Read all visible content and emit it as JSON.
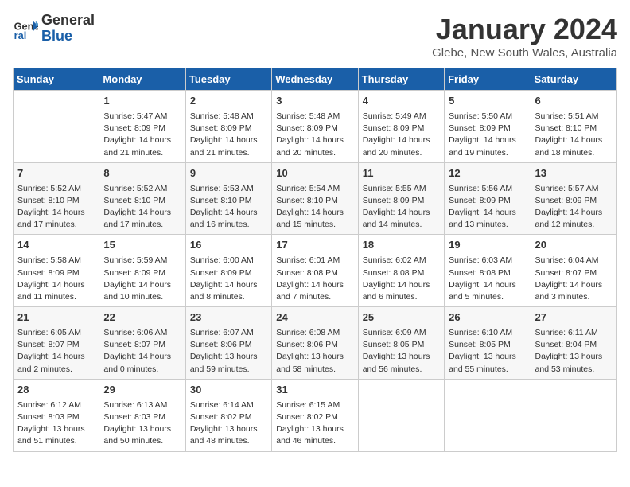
{
  "logo": {
    "line1": "General",
    "line2": "Blue"
  },
  "title": "January 2024",
  "subtitle": "Glebe, New South Wales, Australia",
  "days_of_week": [
    "Sunday",
    "Monday",
    "Tuesday",
    "Wednesday",
    "Thursday",
    "Friday",
    "Saturday"
  ],
  "weeks": [
    [
      {
        "day": "",
        "content": ""
      },
      {
        "day": "1",
        "content": "Sunrise: 5:47 AM\nSunset: 8:09 PM\nDaylight: 14 hours\nand 21 minutes."
      },
      {
        "day": "2",
        "content": "Sunrise: 5:48 AM\nSunset: 8:09 PM\nDaylight: 14 hours\nand 21 minutes."
      },
      {
        "day": "3",
        "content": "Sunrise: 5:48 AM\nSunset: 8:09 PM\nDaylight: 14 hours\nand 20 minutes."
      },
      {
        "day": "4",
        "content": "Sunrise: 5:49 AM\nSunset: 8:09 PM\nDaylight: 14 hours\nand 20 minutes."
      },
      {
        "day": "5",
        "content": "Sunrise: 5:50 AM\nSunset: 8:09 PM\nDaylight: 14 hours\nand 19 minutes."
      },
      {
        "day": "6",
        "content": "Sunrise: 5:51 AM\nSunset: 8:10 PM\nDaylight: 14 hours\nand 18 minutes."
      }
    ],
    [
      {
        "day": "7",
        "content": "Sunrise: 5:52 AM\nSunset: 8:10 PM\nDaylight: 14 hours\nand 17 minutes."
      },
      {
        "day": "8",
        "content": "Sunrise: 5:52 AM\nSunset: 8:10 PM\nDaylight: 14 hours\nand 17 minutes."
      },
      {
        "day": "9",
        "content": "Sunrise: 5:53 AM\nSunset: 8:10 PM\nDaylight: 14 hours\nand 16 minutes."
      },
      {
        "day": "10",
        "content": "Sunrise: 5:54 AM\nSunset: 8:10 PM\nDaylight: 14 hours\nand 15 minutes."
      },
      {
        "day": "11",
        "content": "Sunrise: 5:55 AM\nSunset: 8:09 PM\nDaylight: 14 hours\nand 14 minutes."
      },
      {
        "day": "12",
        "content": "Sunrise: 5:56 AM\nSunset: 8:09 PM\nDaylight: 14 hours\nand 13 minutes."
      },
      {
        "day": "13",
        "content": "Sunrise: 5:57 AM\nSunset: 8:09 PM\nDaylight: 14 hours\nand 12 minutes."
      }
    ],
    [
      {
        "day": "14",
        "content": "Sunrise: 5:58 AM\nSunset: 8:09 PM\nDaylight: 14 hours\nand 11 minutes."
      },
      {
        "day": "15",
        "content": "Sunrise: 5:59 AM\nSunset: 8:09 PM\nDaylight: 14 hours\nand 10 minutes."
      },
      {
        "day": "16",
        "content": "Sunrise: 6:00 AM\nSunset: 8:09 PM\nDaylight: 14 hours\nand 8 minutes."
      },
      {
        "day": "17",
        "content": "Sunrise: 6:01 AM\nSunset: 8:08 PM\nDaylight: 14 hours\nand 7 minutes."
      },
      {
        "day": "18",
        "content": "Sunrise: 6:02 AM\nSunset: 8:08 PM\nDaylight: 14 hours\nand 6 minutes."
      },
      {
        "day": "19",
        "content": "Sunrise: 6:03 AM\nSunset: 8:08 PM\nDaylight: 14 hours\nand 5 minutes."
      },
      {
        "day": "20",
        "content": "Sunrise: 6:04 AM\nSunset: 8:07 PM\nDaylight: 14 hours\nand 3 minutes."
      }
    ],
    [
      {
        "day": "21",
        "content": "Sunrise: 6:05 AM\nSunset: 8:07 PM\nDaylight: 14 hours\nand 2 minutes."
      },
      {
        "day": "22",
        "content": "Sunrise: 6:06 AM\nSunset: 8:07 PM\nDaylight: 14 hours\nand 0 minutes."
      },
      {
        "day": "23",
        "content": "Sunrise: 6:07 AM\nSunset: 8:06 PM\nDaylight: 13 hours\nand 59 minutes."
      },
      {
        "day": "24",
        "content": "Sunrise: 6:08 AM\nSunset: 8:06 PM\nDaylight: 13 hours\nand 58 minutes."
      },
      {
        "day": "25",
        "content": "Sunrise: 6:09 AM\nSunset: 8:05 PM\nDaylight: 13 hours\nand 56 minutes."
      },
      {
        "day": "26",
        "content": "Sunrise: 6:10 AM\nSunset: 8:05 PM\nDaylight: 13 hours\nand 55 minutes."
      },
      {
        "day": "27",
        "content": "Sunrise: 6:11 AM\nSunset: 8:04 PM\nDaylight: 13 hours\nand 53 minutes."
      }
    ],
    [
      {
        "day": "28",
        "content": "Sunrise: 6:12 AM\nSunset: 8:03 PM\nDaylight: 13 hours\nand 51 minutes."
      },
      {
        "day": "29",
        "content": "Sunrise: 6:13 AM\nSunset: 8:03 PM\nDaylight: 13 hours\nand 50 minutes."
      },
      {
        "day": "30",
        "content": "Sunrise: 6:14 AM\nSunset: 8:02 PM\nDaylight: 13 hours\nand 48 minutes."
      },
      {
        "day": "31",
        "content": "Sunrise: 6:15 AM\nSunset: 8:02 PM\nDaylight: 13 hours\nand 46 minutes."
      },
      {
        "day": "",
        "content": ""
      },
      {
        "day": "",
        "content": ""
      },
      {
        "day": "",
        "content": ""
      }
    ]
  ]
}
